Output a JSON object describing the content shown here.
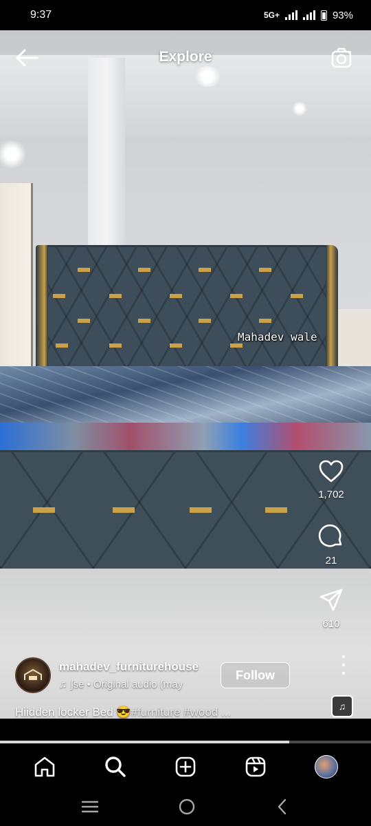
{
  "status_bar": {
    "time": "9:37",
    "network": "5G+",
    "battery": "93%"
  },
  "header": {
    "title": "Explore"
  },
  "video": {
    "watermark_text": "Mahadev wale"
  },
  "actions": {
    "like_count": "1,702",
    "comment_count": "21",
    "share_count": "610"
  },
  "post": {
    "username": "mahadev_furniturehouse",
    "audio": "♫ ʃse • Original audio (may",
    "audio_text": "ʃse • Original audio (may",
    "follow_label": "Follow",
    "caption_text": "Hiidden locker Bed 😎",
    "caption_tags": "#furniture #wood ..."
  },
  "progress": {
    "fraction": 0.78
  },
  "icons": {
    "back": "arrow-left-icon",
    "camera": "camera-icon",
    "like": "heart-icon",
    "comment": "comment-icon",
    "share": "send-icon",
    "more": "more-vertical-icon",
    "home": "home-icon",
    "search": "search-icon",
    "create": "plus-square-icon",
    "reels": "reels-icon"
  }
}
